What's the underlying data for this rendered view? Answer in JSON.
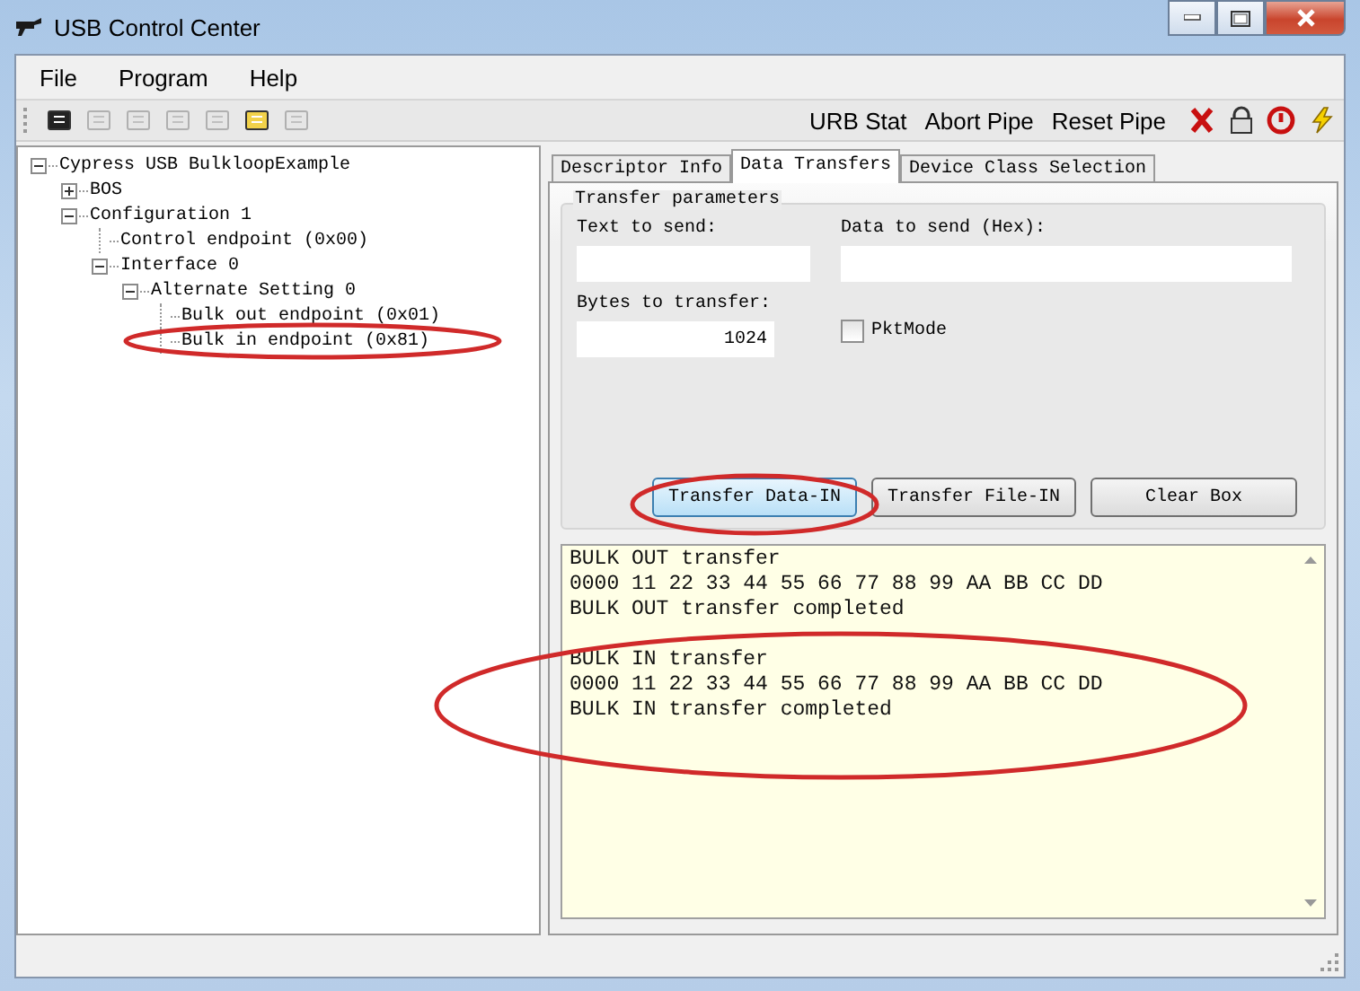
{
  "window": {
    "title": "USB Control Center"
  },
  "menu": [
    "File",
    "Program",
    "Help"
  ],
  "toolbar_icons": [
    {
      "disabled": false
    },
    {
      "disabled": true
    },
    {
      "disabled": true
    },
    {
      "disabled": true
    },
    {
      "disabled": true
    },
    {
      "disabled": false
    },
    {
      "disabled": true
    }
  ],
  "toolbar_actions": [
    "URB Stat",
    "Abort Pipe",
    "Reset Pipe"
  ],
  "tree": [
    {
      "label": "Cypress USB BulkloopExample",
      "expanded": true,
      "children": [
        {
          "label": "BOS",
          "expanded": false
        },
        {
          "label": "Configuration 1",
          "expanded": true,
          "children": [
            {
              "label": "Control endpoint (0x00)"
            },
            {
              "label": "Interface 0",
              "expanded": true,
              "children": [
                {
                  "label": "Alternate Setting 0",
                  "expanded": true,
                  "children": [
                    {
                      "label": "Bulk out endpoint (0x01)"
                    },
                    {
                      "label": "Bulk in endpoint (0x81)"
                    }
                  ]
                }
              ]
            }
          ]
        }
      ]
    }
  ],
  "tabs": [
    {
      "label": "Descriptor Info",
      "selected": false
    },
    {
      "label": "Data Transfers",
      "selected": true
    },
    {
      "label": "Device Class Selection",
      "selected": false
    }
  ],
  "transfer": {
    "group_title": "Transfer parameters",
    "text_label": "Text to send:",
    "hex_label": "Data to send (Hex):",
    "bytes_label": "Bytes to transfer:",
    "bytes_value": "1024",
    "pkt_mode": {
      "label": "PktMode",
      "checked": false
    }
  },
  "buttons": [
    {
      "label": "Transfer Data-IN",
      "focused": true
    },
    {
      "label": "Transfer File-IN",
      "focused": false
    },
    {
      "label": "Clear Box",
      "focused": false
    }
  ],
  "log": [
    [
      "BULK OUT transfer",
      "0000 11 22 33 44 55 66 77 88 99 AA BB CC DD",
      "BULK OUT transfer completed"
    ],
    [
      "BULK IN transfer",
      "0000 11 22 33 44 55 66 77 88 99 AA BB CC DD",
      "BULK IN transfer completed"
    ]
  ]
}
